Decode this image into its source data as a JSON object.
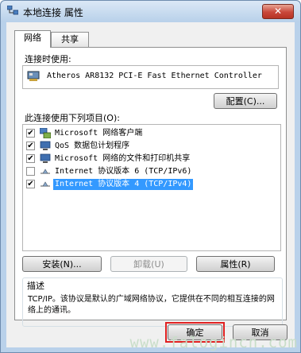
{
  "window": {
    "title": "本地连接 属性",
    "close_label": "✕"
  },
  "tabs": [
    {
      "label": "网络"
    },
    {
      "label": "共享"
    }
  ],
  "network": {
    "connect_using_label": "连接时使用:",
    "adapter_name": "Atheros AR8132 PCI-E Fast Ethernet Controller",
    "configure_label": "配置(C)...",
    "items_label": "此连接使用下列项目(O):",
    "items": [
      {
        "label": "Microsoft 网络客户端",
        "checked": true,
        "icon": "network-client-icon"
      },
      {
        "label": "QoS 数据包计划程序",
        "checked": true,
        "icon": "qos-icon"
      },
      {
        "label": "Microsoft 网络的文件和打印机共享",
        "checked": true,
        "icon": "file-printer-share-icon"
      },
      {
        "label": "Internet 协议版本 6 (TCP/IPv6)",
        "checked": false,
        "icon": "protocol-icon"
      },
      {
        "label": "Internet 协议版本 4 (TCP/IPv4)",
        "checked": true,
        "icon": "protocol-icon",
        "selected": true
      }
    ],
    "install_label": "安装(N)...",
    "uninstall_label": "卸载(U)",
    "properties_label": "属性(R)",
    "description_title": "描述",
    "description_text": "TCP/IP。该协议是默认的广域网络协议，它提供在不同的相互连接的网络上的通讯。"
  },
  "footer": {
    "ok_label": "确定",
    "cancel_label": "取消"
  },
  "watermark": "www.falogincn.com",
  "colors": {
    "selection": "#3399ff",
    "focus_highlight": "#e02020",
    "close_button": "#c9473a"
  }
}
